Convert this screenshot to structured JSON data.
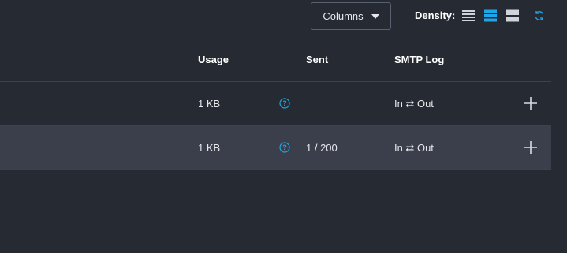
{
  "toolbar": {
    "columns_label": "Columns",
    "density_label": "Density:",
    "density_options": [
      "compact",
      "standard",
      "comfortable"
    ],
    "density_selected": "standard",
    "accent": "#1ea7e8"
  },
  "table": {
    "headers": {
      "usage": "Usage",
      "sent": "Sent",
      "smtp_log": "SMTP Log"
    },
    "rows": [
      {
        "usage": "1 KB",
        "sent": "",
        "smtp_log": "In ⇄ Out"
      },
      {
        "usage": "1 KB",
        "sent": "1 / 200",
        "smtp_log": "In ⇄ Out"
      }
    ]
  }
}
